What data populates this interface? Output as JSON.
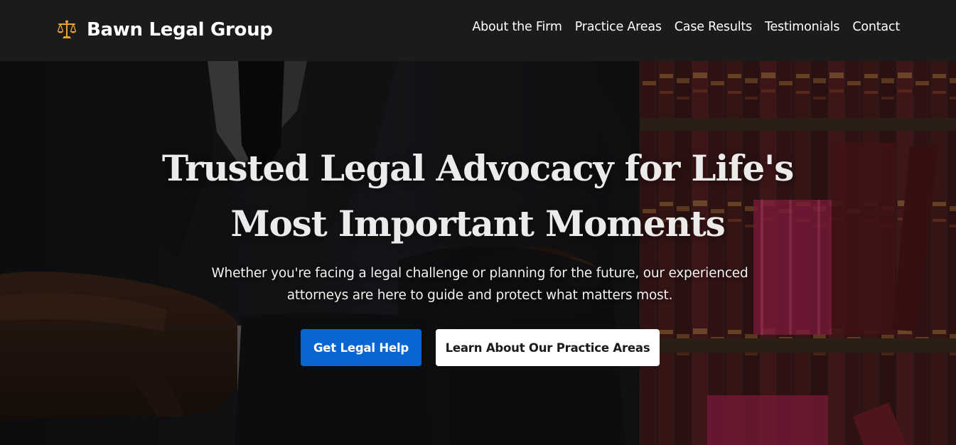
{
  "header": {
    "brand_name": "Bawn Legal Group",
    "brand_icon": "scales-of-justice-icon",
    "nav": [
      {
        "label": "About the Firm"
      },
      {
        "label": "Practice Areas"
      },
      {
        "label": "Case Results"
      },
      {
        "label": "Testimonials"
      },
      {
        "label": "Contact"
      }
    ]
  },
  "hero": {
    "background_image": "attorney-crossed-arms-bookshelf-photo",
    "title": "Trusted Legal Advocacy for Life's Most Important Moments",
    "subtitle": "Whether you're facing a legal challenge or planning for the future, our experienced attorneys are here to guide and protect what matters most.",
    "primary_cta": "Get Legal Help",
    "secondary_cta": "Learn About Our Practice Areas"
  },
  "colors": {
    "header_bg": "#1b1b1b",
    "primary_button": "#0866d4",
    "secondary_button": "#ffffff",
    "brand_icon_gold": "#e7a33a"
  }
}
